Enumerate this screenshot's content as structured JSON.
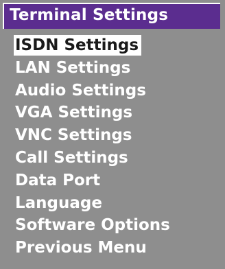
{
  "window": {
    "title": "Terminal Settings"
  },
  "menu": {
    "selected_index": 0,
    "items": [
      {
        "label": "ISDN Settings"
      },
      {
        "label": "LAN Settings"
      },
      {
        "label": "Audio Settings"
      },
      {
        "label": "VGA Settings"
      },
      {
        "label": "VNC Settings"
      },
      {
        "label": "Call Settings"
      },
      {
        "label": "Data Port"
      },
      {
        "label": "Language"
      },
      {
        "label": "Software Options"
      },
      {
        "label": "Previous Menu"
      }
    ]
  },
  "colors": {
    "background": "#8e8e8e",
    "title_bar": "#5b2d8f",
    "text": "#ffffff",
    "highlight": "#ffffff",
    "highlight_text": "#1a1a1a"
  }
}
